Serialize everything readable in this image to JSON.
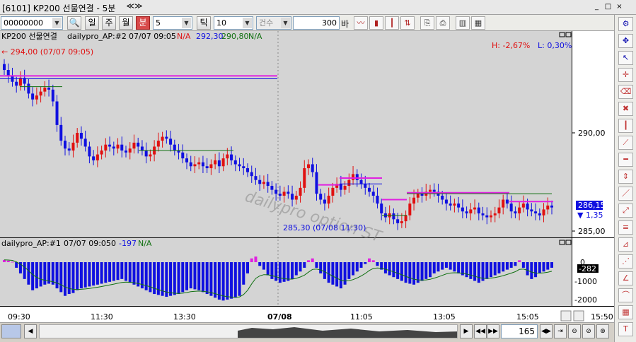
{
  "window": {
    "title": "[6101] KP200 선물연결 - 5분",
    "nav": "≪≫",
    "buttons": [
      "_",
      "□",
      "×"
    ]
  },
  "toolbar": {
    "code": "00000000",
    "period_buttons": [
      "일",
      "주",
      "월",
      "분"
    ],
    "active_period": "분",
    "interval": "5",
    "tick_label": "틱",
    "tick_value": "10",
    "count_type": "건수",
    "count_value": "300",
    "count_unit": "바"
  },
  "main_panel": {
    "legend_name": "KP200 선물연결",
    "legend_indicator": "dailypro_AP:#2",
    "legend_date": "07/07 09:05",
    "legend_na": "N/A",
    "legend_v1": "292,30",
    "legend_v2": "290,80",
    "legend_v3": "N/A",
    "high_label": "H: -2,67%",
    "low_label": "L: 0,30%",
    "max_annotation": "← 294,00 (07/07 09:05)",
    "min_annotation": "285,30 (07/08 11:30)",
    "watermark": "dailypro option ST",
    "price_ticks": [
      "290,00",
      "285,00"
    ],
    "last_price": "286,15",
    "change": "▼ 1,35"
  },
  "sub_panel": {
    "legend": "dailypro_AP:#1",
    "legend_date": "07/07 09:05",
    "legend_value": "0",
    "legend_v2": "-197",
    "legend_na": "N/A",
    "ticks": [
      "0",
      "-1000",
      "-2000"
    ],
    "last_value": "-282"
  },
  "time_axis": [
    "09:30",
    "11:30",
    "13:30",
    "07/08",
    "11:05",
    "13:05",
    "15:05"
  ],
  "time_right": "15:50",
  "bottom": {
    "count": "165"
  },
  "colors": {
    "up": "#e01010",
    "down": "#1010e0",
    "magenta": "#e020e0",
    "green": "#107010",
    "bg": "#ffffff"
  },
  "chart_data": {
    "type": "candlestick",
    "price_axis_ticks": [
      290.0,
      285.0
    ],
    "max_price": 294.0,
    "max_label_time": "07/07 09:05",
    "min_price": 285.3,
    "min_label_time": "07/08 11:30",
    "last_price": 286.15,
    "change": -1.35,
    "closes": [
      293.2,
      292.9,
      292.6,
      292.4,
      292.8,
      292.5,
      292.0,
      291.7,
      291.9,
      292.1,
      292.3,
      292.2,
      291.6,
      290.4,
      289.6,
      289.2,
      289.1,
      289.5,
      290.0,
      289.7,
      289.3,
      288.8,
      288.6,
      288.9,
      289.1,
      289.4,
      289.3,
      289.2,
      289.4,
      289.1,
      289.0,
      289.2,
      289.5,
      289.3,
      289.1,
      288.8,
      288.9,
      289.3,
      289.6,
      289.8,
      289.7,
      289.4,
      289.1,
      289.0,
      288.7,
      288.5,
      288.3,
      288.4,
      288.5,
      288.3,
      288.2,
      288.4,
      288.6,
      288.3,
      288.7,
      288.9,
      288.6,
      288.4,
      288.3,
      288.2,
      288.0,
      287.8,
      287.6,
      287.4,
      287.5,
      287.3,
      287.1,
      286.9,
      286.8,
      287.0,
      286.9,
      286.6,
      286.8,
      287.2,
      288.2,
      288.4,
      288.0,
      286.9,
      286.6,
      286.4,
      286.8,
      287.2,
      287.4,
      287.1,
      287.3,
      287.6,
      287.9,
      287.6,
      287.4,
      287.2,
      287.0,
      286.8,
      286.4,
      285.9,
      285.7,
      285.9,
      285.6,
      285.4,
      285.5,
      285.8,
      286.4,
      286.7,
      286.9,
      286.8,
      287.0,
      287.1,
      287.0,
      286.8,
      286.6,
      286.4,
      286.3,
      286.4,
      286.2,
      286.0,
      285.9,
      286.1,
      286.2,
      285.9,
      285.8,
      285.7,
      285.8,
      285.9,
      286.2,
      286.6,
      286.4,
      286.0,
      285.9,
      286.2,
      286.4,
      286.1,
      286.0,
      285.9,
      285.8,
      286.1,
      286.3,
      286.2
    ],
    "ap1_values": [
      120,
      80,
      20,
      -300,
      -600,
      -900,
      -1200,
      -1500,
      -1400,
      -1300,
      -1200,
      -1150,
      -1200,
      -1400,
      -1600,
      -1800,
      -1700,
      -1650,
      -1500,
      -1400,
      -1350,
      -1300,
      -1250,
      -1200,
      -1150,
      -1100,
      -1050,
      -1000,
      -950,
      -900,
      -1000,
      -1100,
      -1200,
      -1300,
      -1400,
      -1500,
      -1600,
      -1700,
      -1750,
      -1800,
      -1850,
      -1800,
      -1750,
      -1700,
      -1600,
      -1500,
      -1400,
      -1450,
      -1500,
      -1600,
      -1700,
      -1800,
      -1900,
      -2000,
      -2050,
      -2000,
      -1950,
      -1900,
      -1800,
      -1200,
      -600,
      200,
      300,
      -200,
      -400,
      -700,
      -900,
      -1000,
      -1100,
      -1050,
      -1000,
      -900,
      -700,
      -500,
      -300,
      100,
      200,
      -300,
      -600,
      -900,
      -1100,
      -1200,
      -1300,
      -1400,
      -1200,
      -900,
      -700,
      -500,
      -300,
      -100,
      200,
      100,
      -200,
      -400,
      -600,
      -700,
      -800,
      -900,
      -1000,
      -1100,
      -1150,
      -1200,
      -1100,
      -1000,
      -900,
      -800,
      -600,
      -500,
      -400,
      -300,
      -400,
      -500,
      -600,
      -700,
      -800,
      -900,
      -1000,
      -1100,
      -1000,
      -900,
      -800,
      -700,
      -600,
      -500,
      -400,
      -300,
      -200,
      100,
      -300,
      -700,
      -900,
      -800,
      -600,
      -500,
      -400,
      -300
    ]
  }
}
